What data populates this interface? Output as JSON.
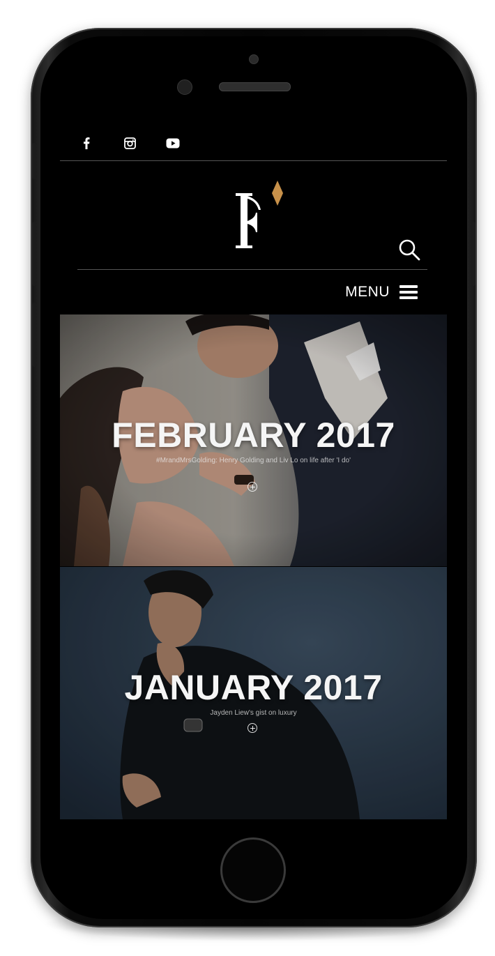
{
  "social": [
    {
      "name": "facebook-icon",
      "glyph": "f"
    },
    {
      "name": "instagram-icon",
      "glyph": ""
    },
    {
      "name": "youtube-icon",
      "glyph": ""
    }
  ],
  "header": {
    "logo_text": "F",
    "search_icon": "search-icon",
    "menu_label": "MENU"
  },
  "issues": [
    {
      "title": "FEBRUARY 2017",
      "subtitle": "#MrandMrsGolding: Henry Golding and Liv Lo on life after 'I do'",
      "accent": "#4a4a4a"
    },
    {
      "title": "JANUARY 2017",
      "subtitle": "Jayden Liew's gist on luxury",
      "accent": "#2c3b4c"
    }
  ],
  "colors": {
    "screen_bg": "#000000",
    "logo_diamond": "#c8914a",
    "text": "#ffffff"
  }
}
